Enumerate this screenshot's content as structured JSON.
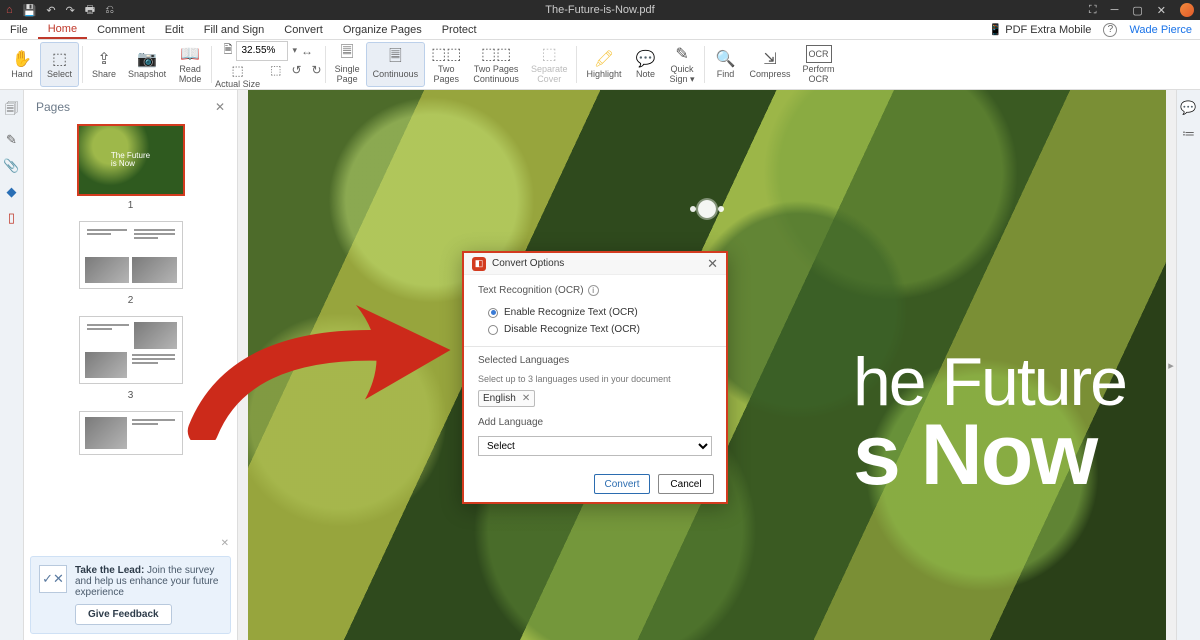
{
  "titlebar": {
    "document_title": "The-Future-is-Now.pdf"
  },
  "menubar": {
    "items": [
      "File",
      "Home",
      "Comment",
      "Edit",
      "Fill and Sign",
      "Convert",
      "Organize Pages",
      "Protect"
    ],
    "active_index": 1,
    "mobile_label": "PDF Extra Mobile",
    "user_name": "Wade Pierce"
  },
  "ribbon": {
    "zoom_value": "32.55%",
    "groups": [
      {
        "icon": "✋",
        "label": "Hand"
      },
      {
        "icon": "⬚",
        "label": "Select",
        "selected": true
      },
      {
        "sep": true
      },
      {
        "icon": "⇪",
        "label": "Share"
      },
      {
        "icon": "📷",
        "label": "Snapshot"
      },
      {
        "icon": "📖",
        "label": "Read\nMode"
      },
      {
        "sep": true
      },
      {
        "icon": "🗎",
        "label": "Actual\nSize",
        "zoombox": true
      },
      {
        "sep": true
      },
      {
        "icon": "🗏",
        "label": "Single\nPage"
      },
      {
        "icon": "🗏🗏",
        "label": "Continuous",
        "selected": true
      },
      {
        "icon": "⬚⬚",
        "label": "Two\nPages"
      },
      {
        "icon": "⬚⬚",
        "label": "Two Pages\nContinuous"
      },
      {
        "icon": "⬚",
        "label": "Separate\nCover",
        "disabled": true
      },
      {
        "sep": true
      },
      {
        "icon": "🖍",
        "label": "Highlight"
      },
      {
        "icon": "💬",
        "label": "Note"
      },
      {
        "icon": "✎",
        "label": "Quick\nSign ▾"
      },
      {
        "sep": true
      },
      {
        "icon": "🔍",
        "label": "Find"
      },
      {
        "icon": "⇲",
        "label": "Compress"
      },
      {
        "icon": "OCR",
        "label": "Perform\nOCR"
      }
    ]
  },
  "pages_panel": {
    "title": "Pages",
    "thumbs": [
      "1",
      "2",
      "3",
      ""
    ],
    "thumb1_line1": "The Future",
    "thumb1_line2": "is Now"
  },
  "survey": {
    "bold": "Take the Lead:",
    "text": " Join the survey and help us enhance your future experience",
    "button": "Give Feedback"
  },
  "hero": {
    "line1": "he Future",
    "line2": "s Now"
  },
  "dialog": {
    "title": "Convert Options",
    "section_ocr": "Text Recognition (OCR)",
    "radio_enable": "Enable Recognize Text (OCR)",
    "radio_disable": "Disable Recognize Text (OCR)",
    "section_langs": "Selected Languages",
    "langs_hint": "Select up to 3 languages used in your document",
    "chip_english": "English",
    "add_language": "Add Language",
    "select_placeholder": "Select",
    "btn_convert": "Convert",
    "btn_cancel": "Cancel"
  }
}
